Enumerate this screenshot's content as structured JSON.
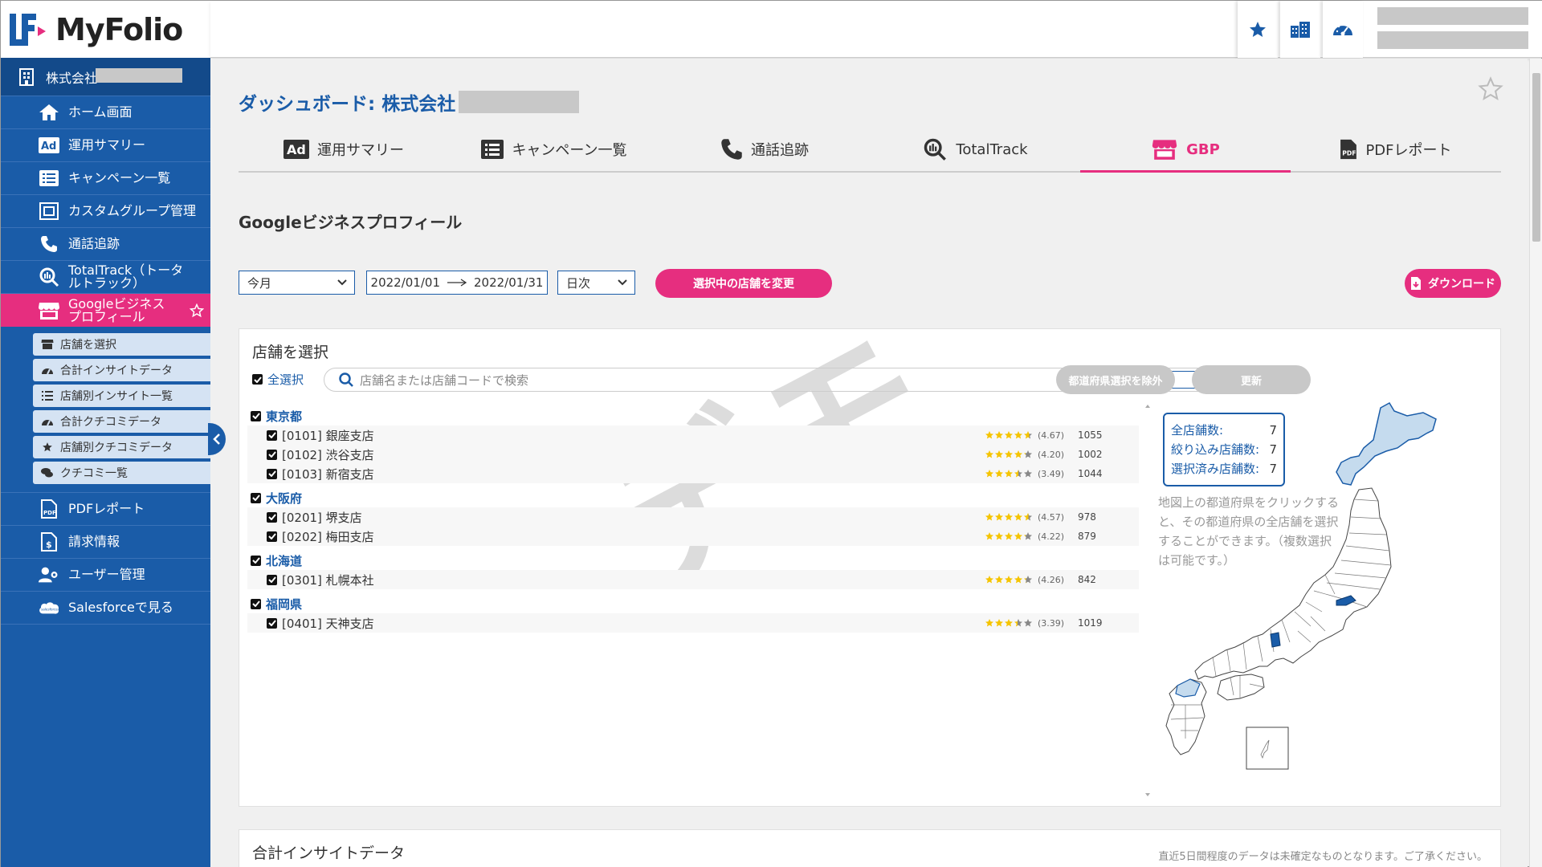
{
  "app": {
    "name": "MyFolio"
  },
  "sidebar": {
    "company_prefix": "株式会社",
    "items": [
      {
        "label": "ホーム画面",
        "icon": "home-icon"
      },
      {
        "label": "運用サマリー",
        "icon": "ad-icon"
      },
      {
        "label": "キャンペーン一覧",
        "icon": "list-icon"
      },
      {
        "label": "カスタムグループ管理",
        "icon": "group-icon"
      },
      {
        "label": "通話追跡",
        "icon": "phone-icon"
      },
      {
        "label": "TotalTrack（トータルトラック）",
        "icon": "totaltrack-icon"
      },
      {
        "label": "Googleビジネスプロフィール",
        "icon": "store-icon",
        "active": true
      },
      {
        "label": "PDFレポート",
        "icon": "pdf-icon"
      },
      {
        "label": "請求情報",
        "icon": "invoice-icon"
      },
      {
        "label": "ユーザー管理",
        "icon": "users-icon"
      },
      {
        "label": "Salesforceで見る",
        "icon": "salesforce-icon"
      }
    ],
    "subitems": [
      {
        "label": "店舗を選択",
        "icon": "store-select-icon"
      },
      {
        "label": "合計インサイトデータ",
        "icon": "gauge-icon"
      },
      {
        "label": "店舗別インサイト一覧",
        "icon": "list-icon"
      },
      {
        "label": "合計クチコミデータ",
        "icon": "gauge-icon"
      },
      {
        "label": "店舗別クチコミデータ",
        "icon": "star-icon"
      },
      {
        "label": "クチコミ一覧",
        "icon": "comments-icon"
      }
    ]
  },
  "header": {
    "page_title_prefix": "ダッシュボード: 株式会社",
    "icons": [
      "star-icon",
      "building-icon",
      "dashboard-icon"
    ]
  },
  "tabs": [
    {
      "label": "運用サマリー",
      "icon": "ad-icon"
    },
    {
      "label": "キャンペーン一覧",
      "icon": "list-icon"
    },
    {
      "label": "通話追跡",
      "icon": "phone-icon"
    },
    {
      "label": "TotalTrack",
      "icon": "totaltrack-icon"
    },
    {
      "label": "GBP",
      "icon": "store-icon",
      "active": true
    },
    {
      "label": "PDFレポート",
      "icon": "pdf-icon"
    }
  ],
  "section": {
    "title": "Googleビジネスプロフィール"
  },
  "controls": {
    "period": "今月",
    "date_from": "2022/01/01",
    "date_to": "2022/01/31",
    "granularity": "日次",
    "change_stores_label": "選択中の店舗を変更",
    "download_label": "ダウンロード"
  },
  "store_panel": {
    "title": "店舗を選択",
    "select_all_label": "全選択",
    "search_placeholder": "店舗名または店舗コードで検索",
    "search_button": "検索",
    "exclude_pref_button": "都道府県選択を除外",
    "update_button": "更新",
    "watermark": "デモ",
    "groups": [
      {
        "prefecture": "東京都",
        "stores": [
          {
            "label": "[0101] 銀座支店",
            "rating": 4.67,
            "rating_text": "(4.67)",
            "reviews": "1055"
          },
          {
            "label": "[0102] 渋谷支店",
            "rating": 4.2,
            "rating_text": "(4.20)",
            "reviews": "1002"
          },
          {
            "label": "[0103] 新宿支店",
            "rating": 3.49,
            "rating_text": "(3.49)",
            "reviews": "1044"
          }
        ]
      },
      {
        "prefecture": "大阪府",
        "stores": [
          {
            "label": "[0201] 堺支店",
            "rating": 4.57,
            "rating_text": "(4.57)",
            "reviews": "978"
          },
          {
            "label": "[0202] 梅田支店",
            "rating": 4.22,
            "rating_text": "(4.22)",
            "reviews": "879"
          }
        ]
      },
      {
        "prefecture": "北海道",
        "stores": [
          {
            "label": "[0301] 札幌本社",
            "rating": 4.26,
            "rating_text": "(4.26)",
            "reviews": "842"
          }
        ]
      },
      {
        "prefecture": "福岡県",
        "stores": [
          {
            "label": "[0401] 天神支店",
            "rating": 3.39,
            "rating_text": "(3.39)",
            "reviews": "1019"
          }
        ]
      }
    ],
    "counts": {
      "total_label": "全店舗数:",
      "total": "7",
      "filtered_label": "絞り込み店舗数:",
      "filtered": "7",
      "selected_label": "選択済み店舗数:",
      "selected": "7"
    },
    "map_hint": "地図上の都道府県をクリックすると、その都道府県の全店舗を選択することができます。（複数選択は可能です。）"
  },
  "insight_panel": {
    "title": "合計インサイトデータ",
    "note": "直近5日間程度のデータは未確定なものとなります。ご了承ください。"
  },
  "colors": {
    "brand_blue": "#1a5ca8",
    "accent_pink": "#e62e7f",
    "star_gold": "#f5c400"
  }
}
